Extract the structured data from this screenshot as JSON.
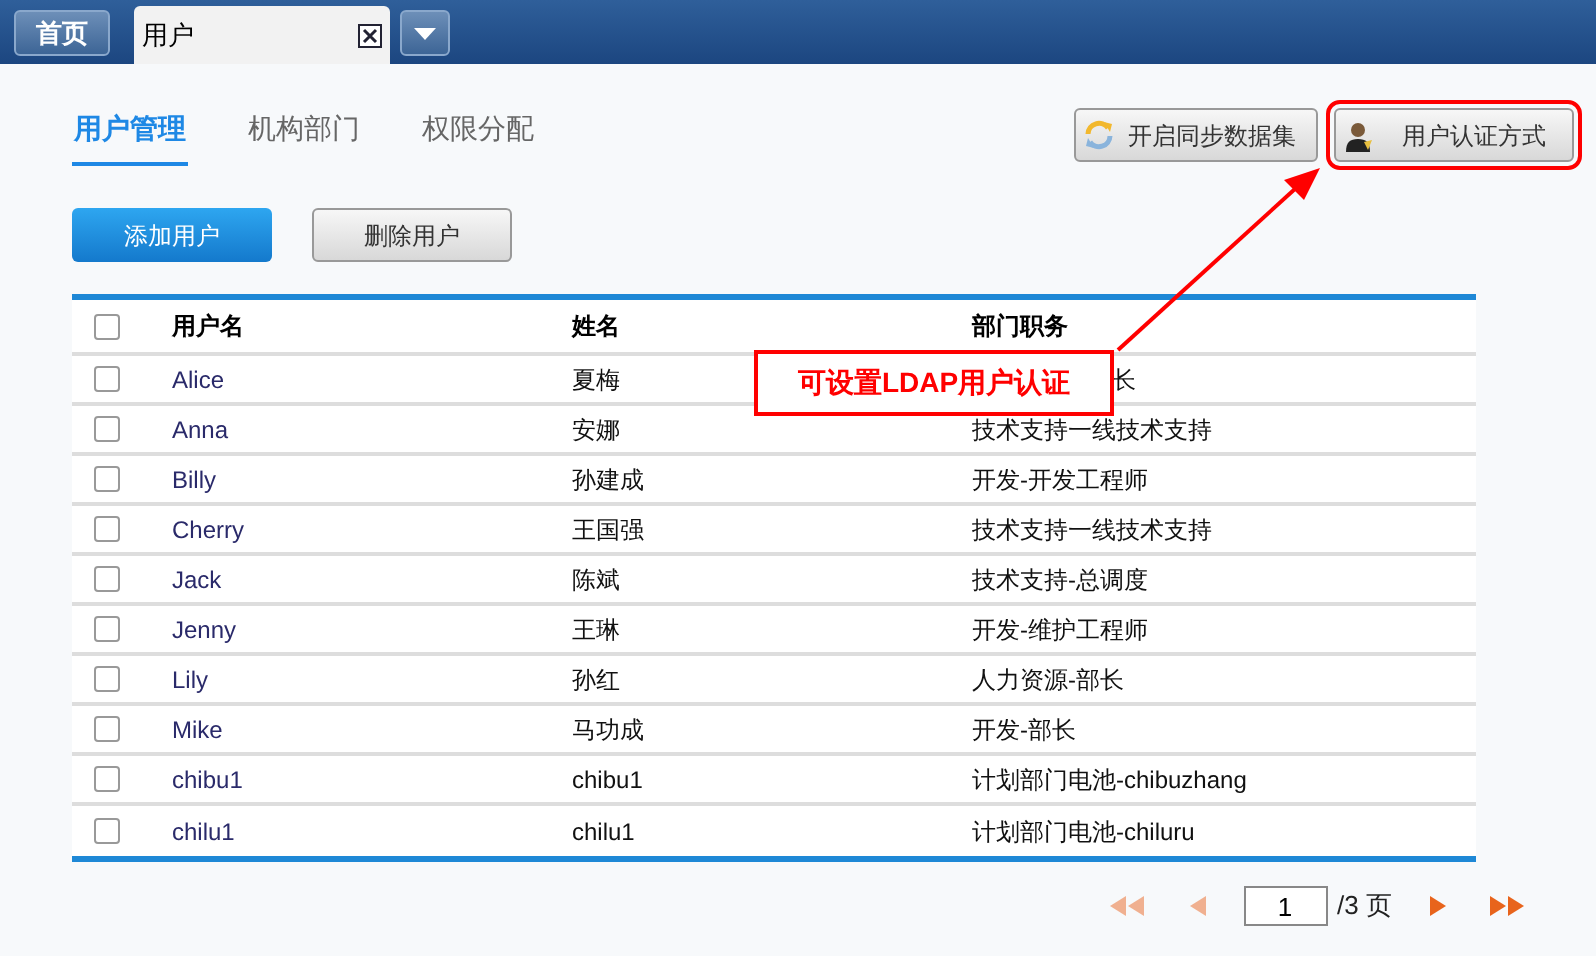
{
  "top_tabs": [
    {
      "label": "首页",
      "kind": "home",
      "selected": false
    },
    {
      "label": "用户",
      "kind": "tab",
      "selected": true
    }
  ],
  "sub_tabs": [
    {
      "label": "用户管理",
      "selected": true
    },
    {
      "label": "机构部门",
      "selected": false
    },
    {
      "label": "权限分配",
      "selected": false
    }
  ],
  "actions": {
    "sync": "开启同步数据集",
    "auth": "用户认证方式",
    "add": "添加用户",
    "delete": "删除用户"
  },
  "table": {
    "all_checked": false,
    "columns": [
      "用户名",
      "姓名",
      "部门职务"
    ],
    "rows": [
      {
        "checked": false,
        "cells": [
          "Alice",
          "夏梅",
          "长"
        ],
        "covered": true
      },
      {
        "checked": false,
        "cells": [
          "Anna",
          "安娜",
          "技术支持一线技术支持"
        ]
      },
      {
        "checked": false,
        "cells": [
          "Billy",
          "孙建成",
          "开发-开发工程师"
        ]
      },
      {
        "checked": false,
        "cells": [
          "Cherry",
          "王国强",
          "技术支持一线技术支持"
        ]
      },
      {
        "checked": false,
        "cells": [
          "Jack",
          "陈斌",
          "技术支持-总调度"
        ]
      },
      {
        "checked": false,
        "cells": [
          "Jenny",
          "王琳",
          "开发-维护工程师"
        ]
      },
      {
        "checked": false,
        "cells": [
          "Lily",
          "孙红",
          "人力资源-部长"
        ]
      },
      {
        "checked": false,
        "cells": [
          "Mike",
          "马功成",
          "开发-部长"
        ]
      },
      {
        "checked": false,
        "cells": [
          "chibu1",
          "chibu1",
          "计划部门电池-chibuzhang"
        ]
      },
      {
        "checked": false,
        "cells": [
          "chilu1",
          "chilu1",
          "计划部门电池-chiluru"
        ]
      }
    ]
  },
  "pagination": {
    "page": "1",
    "total": "/3 页",
    "first_disabled": true,
    "prev_disabled": true,
    "next_disabled": false,
    "last_disabled": false
  },
  "callout": {
    "text": "可设置LDAP用户认证"
  }
}
